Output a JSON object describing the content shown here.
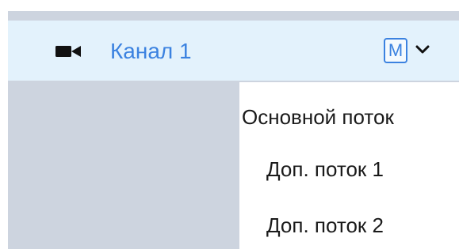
{
  "channel": {
    "label": "Канал 1",
    "icon": "video-camera-icon",
    "stream_badge": "M",
    "label_color": "#3b82e0"
  },
  "dropdown": {
    "items": [
      {
        "label": "Основной поток"
      },
      {
        "label": "Доп. поток 1"
      },
      {
        "label": "Доп. поток 2"
      }
    ]
  }
}
